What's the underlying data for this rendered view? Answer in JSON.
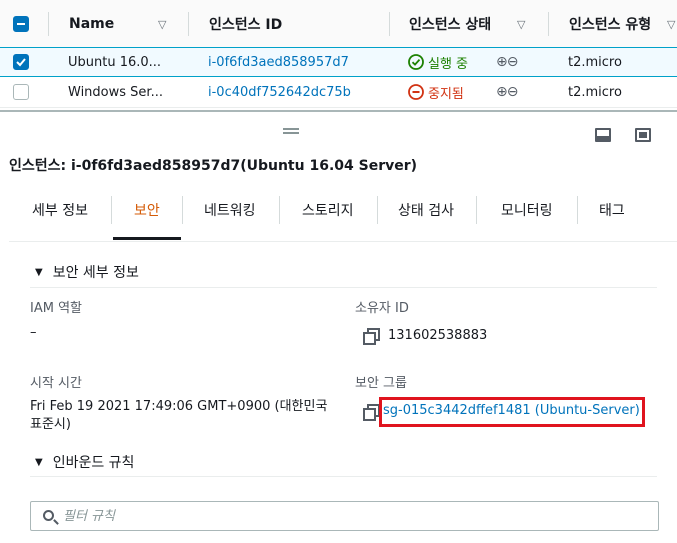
{
  "table": {
    "headers": {
      "name": "Name",
      "id": "인스턴스 ID",
      "state": "인스턴스 상태",
      "type": "인스턴스 유형"
    },
    "sort_glyph": "▽",
    "rows": [
      {
        "name": "Ubuntu 16.0...",
        "id": "i-0f6fd3aed858957d7",
        "state_icon": "✓",
        "state": "실행 중",
        "zoom": "⊕⊖",
        "type": "t2.micro",
        "checked": true
      },
      {
        "name": "Windows Ser...",
        "id": "i-0c40df752642dc75b",
        "state_icon": "⊖",
        "state": "중지됨",
        "zoom": "⊕⊖",
        "type": "t2.micro",
        "checked": false
      }
    ]
  },
  "detail": {
    "title": "인스턴스: i-0f6fd3aed858957d7(Ubuntu 16.04 Server)",
    "tabs": [
      "세부 정보",
      "보안",
      "네트워킹",
      "스토리지",
      "상태 검사",
      "모니터링",
      "태그"
    ],
    "active_tab": "보안",
    "security_section": {
      "heading": "보안 세부 정보",
      "iam_label": "IAM 역할",
      "iam_value": "–",
      "owner_label": "소유자 ID",
      "owner_value": "131602538883",
      "launch_label": "시작 시간",
      "launch_value": "Fri Feb 19 2021 17:49:06 GMT+0900 (대한민국 표준시)",
      "sg_label": "보안 그룹",
      "sg_value": "sg-015c3442dffef1481 (Ubuntu-Server)"
    },
    "inbound": {
      "heading": "인바운드 규칙",
      "filter_placeholder": "필터 규칙"
    }
  },
  "colors": {
    "link": "#0073bb",
    "running": "#1d8102",
    "stopped": "#d13212",
    "active_tab": "#d45b07",
    "highlight": "#e0141e"
  },
  "icons": [
    "checkbox-icon",
    "caret-down-icon",
    "check-circle-icon",
    "stop-circle-icon",
    "zoom-in-icon",
    "zoom-out-icon",
    "drag-handle-icon",
    "pane-bottom-icon",
    "pane-full-icon",
    "copy-icon",
    "search-icon",
    "triangle-down-icon"
  ]
}
